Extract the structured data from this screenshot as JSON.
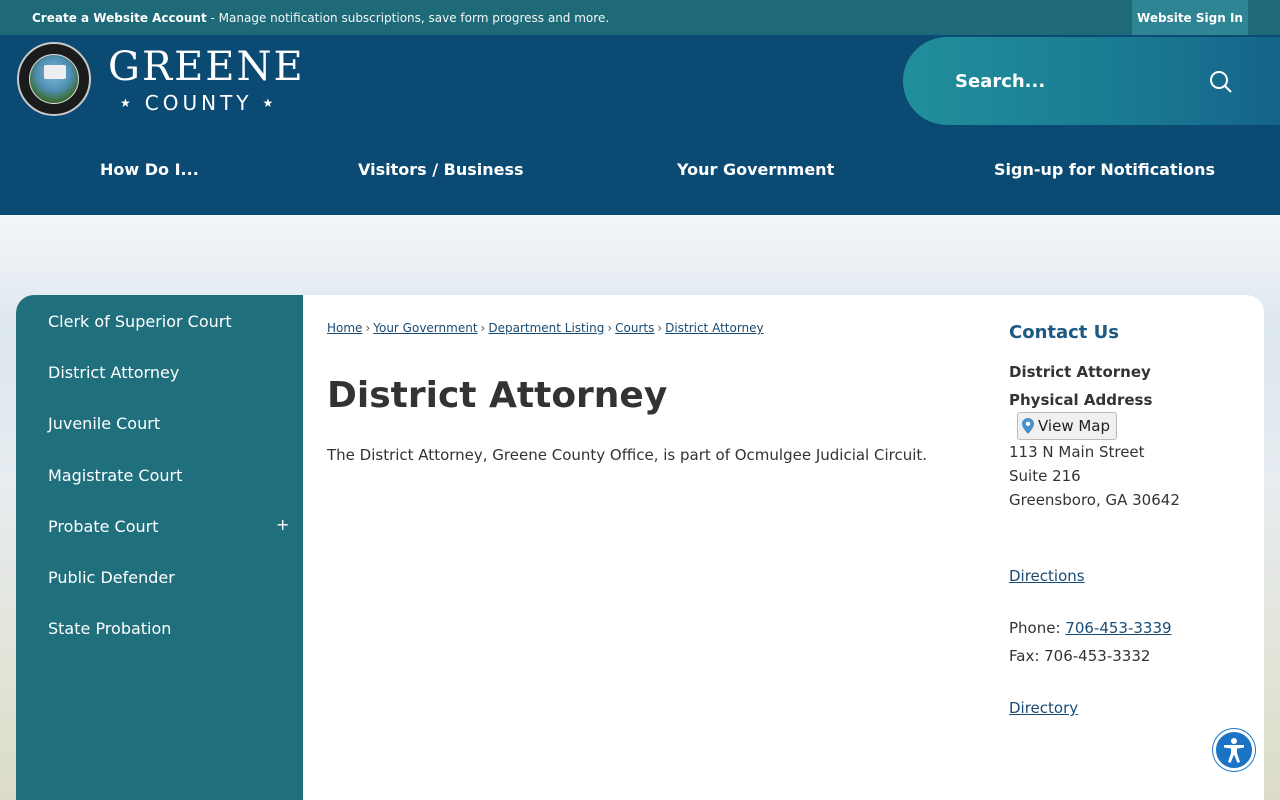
{
  "topbar": {
    "account_link": "Create a Website Account",
    "account_text": " - Manage notification subscriptions, save form progress and more.",
    "signin": "Website Sign In"
  },
  "brand": {
    "name_line1": "GREENE",
    "name_line2": "COUNTY",
    "star": "★"
  },
  "search": {
    "placeholder": "Search..."
  },
  "nav": [
    "How Do I...",
    "Visitors / Business",
    "Your Government",
    "Sign-up for Notifications"
  ],
  "sidebar": {
    "items": [
      {
        "label": "Clerk of Superior Court"
      },
      {
        "label": "District Attorney"
      },
      {
        "label": "Juvenile Court"
      },
      {
        "label": "Magistrate Court"
      },
      {
        "label": "Probate Court",
        "expand": "+"
      },
      {
        "label": "Public Defender"
      },
      {
        "label": "State Probation"
      }
    ]
  },
  "breadcrumb": {
    "items": [
      "Home",
      "Your Government",
      "Department Listing",
      "Courts",
      "District Attorney"
    ],
    "separator": "›"
  },
  "page": {
    "title": "District Attorney",
    "description": "The District Attorney, Greene County Office, is part of Ocmulgee Judicial Circuit."
  },
  "contact": {
    "heading": "Contact Us",
    "department": "District Attorney",
    "physical_address_label": "Physical Address",
    "view_map": "View Map",
    "address_line1": "113 N Main Street",
    "address_line2": "Suite 216",
    "address_line3": "Greensboro, GA 30642",
    "directions": "Directions",
    "phone_label": "Phone: ",
    "phone": "706-453-3339",
    "fax": "Fax: 706-453-3332",
    "directory": "Directory"
  },
  "colors": {
    "topbar": "#1f6a78",
    "header": "#0b4a72",
    "sidebar": "#206f7d",
    "link": "#1a4b74",
    "accessibility": "#1a73c5"
  }
}
